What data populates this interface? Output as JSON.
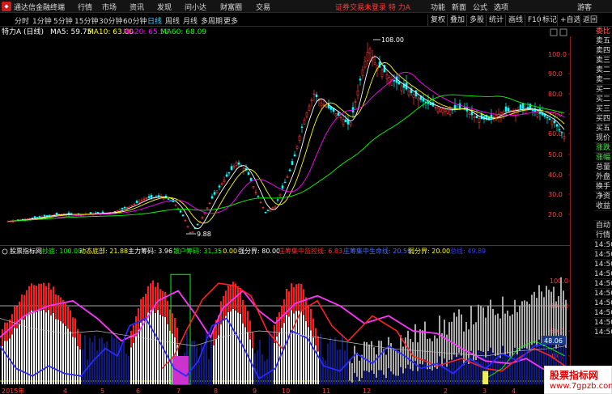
{
  "menu": {
    "app_name": "通达信金融终端",
    "items": [
      "行情",
      "市场",
      "资讯",
      "发现",
      "问小达",
      "财富圈",
      "交易"
    ],
    "status": "证券交易未登录 特 力A",
    "sys_items": [
      "功能",
      "新面",
      "公式",
      "选项"
    ],
    "guest": "游客"
  },
  "toolbar": {
    "periods": [
      "分时",
      "1分钟",
      "5分钟",
      "15分钟",
      "30分钟",
      "60分钟",
      "日线",
      "周线",
      "月线",
      "多周期",
      "更多"
    ],
    "active_period": "日线",
    "right_buttons": [
      "复权",
      "叠加",
      "多股",
      "统计",
      "画线",
      "F10",
      "标记",
      "+自选",
      "返回"
    ]
  },
  "main_chart": {
    "stock_label": "特力A (日线)",
    "ma_legend": [
      {
        "label": "MA5: 59.75",
        "color": "#ffffff"
      },
      {
        "label": "MA10: 63.00",
        "color": "#ffff00"
      },
      {
        "label": "MA20: 65.50",
        "color": "#ff00ff"
      },
      {
        "label": "MA60: 68.09",
        "color": "#00ff00"
      }
    ],
    "y_ticks": [
      "100.0",
      "90.0",
      "80.0",
      "70.0",
      "60.0",
      "50.0",
      "40.0",
      "30.0",
      "20.0"
    ],
    "high_marker": "108.00",
    "low_marker": "9.88"
  },
  "indicator": {
    "name": "股票指标网",
    "legend": [
      {
        "label": "抄底: 100.00",
        "color": "#00ff00"
      },
      {
        "label": "动态底部: 21.88",
        "color": "#ffff00"
      },
      {
        "label": "主力筹码: 3.96",
        "color": "#ffffff"
      },
      {
        "label": "散户筹码: 31.35",
        "color": "#00ff00"
      },
      {
        "label": ": 0.00",
        "color": "#ffff00"
      },
      {
        "label": "强分界: 80.00",
        "color": "#ffffff"
      },
      {
        "label": "庄筹集中监控线: 6.83",
        "color": "#ff3030"
      },
      {
        "label": "庄筹集中生命线: 20.59",
        "color": "#4d6dff"
      },
      {
        "label": "弱分界: 20.00",
        "color": "#ffff00"
      },
      {
        "label": "总线: 49.89",
        "color": "#3b3bff"
      }
    ],
    "y_ticks": [
      "100.0",
      "80.00",
      "60.0",
      "40.0",
      "20.00"
    ],
    "value_badge": "48.06",
    "buy_marker": "买"
  },
  "x_axis": {
    "labels": [
      "2015年",
      "4",
      "5",
      "6",
      "7",
      "8",
      "9",
      "10",
      "11",
      "12",
      "2",
      "3",
      "4"
    ]
  },
  "sidebar": {
    "items": [
      {
        "label": "委比",
        "tone": "red"
      },
      {
        "label": "卖五",
        "tone": "plain"
      },
      {
        "label": "卖四",
        "tone": "plain"
      },
      {
        "label": "卖三",
        "tone": "plain"
      },
      {
        "label": "卖二",
        "tone": "plain"
      },
      {
        "label": "卖一",
        "tone": "plain"
      },
      {
        "label": "买一",
        "tone": "plain"
      },
      {
        "label": "买二",
        "tone": "plain"
      },
      {
        "label": "买三",
        "tone": "plain"
      },
      {
        "label": "买四",
        "tone": "plain"
      },
      {
        "label": "买五",
        "tone": "plain"
      },
      {
        "label": "现价",
        "tone": "plain"
      },
      {
        "label": "涨跌",
        "tone": "green"
      },
      {
        "label": "涨幅",
        "tone": "green"
      },
      {
        "label": "总量",
        "tone": "plain"
      },
      {
        "label": "外盘",
        "tone": "plain"
      },
      {
        "label": "换手",
        "tone": "plain"
      },
      {
        "label": "净资",
        "tone": "plain"
      },
      {
        "label": "收益",
        "tone": "plain"
      },
      {
        "label": "",
        "tone": "plain"
      },
      {
        "label": "自动",
        "tone": "plain"
      },
      {
        "label": "行情",
        "tone": "plain"
      },
      {
        "label": "14:50",
        "tone": "plain"
      },
      {
        "label": "14:50",
        "tone": "plain"
      },
      {
        "label": "14:50",
        "tone": "plain"
      },
      {
        "label": "14:50",
        "tone": "plain"
      },
      {
        "label": "14:50",
        "tone": "plain"
      },
      {
        "label": "14:50",
        "tone": "plain"
      },
      {
        "label": "14:50",
        "tone": "plain"
      },
      {
        "label": "14:50",
        "tone": "plain"
      },
      {
        "label": "14:50",
        "tone": "plain"
      },
      {
        "label": "14:50",
        "tone": "plain"
      }
    ]
  },
  "watermark": {
    "line1": "股票指标网",
    "line2": "www.7gpzb.com"
  }
}
